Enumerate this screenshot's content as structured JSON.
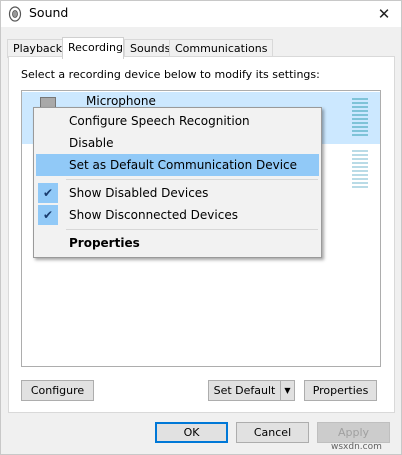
{
  "window": {
    "title": "Sound",
    "icons": {
      "app": "speaker-icon",
      "close": "close-icon"
    },
    "close_glyph": "✕"
  },
  "tabs": [
    {
      "label": "Playback",
      "active": false
    },
    {
      "label": "Recording",
      "active": true
    },
    {
      "label": "Sounds",
      "active": false
    },
    {
      "label": "Communications",
      "active": false
    }
  ],
  "panel": {
    "instruction": "Select a recording device below to modify its settings:",
    "devices": [
      {
        "name": "Microphone",
        "selected": true
      },
      {
        "name": "",
        "selected": false
      }
    ]
  },
  "context_menu": {
    "items": [
      {
        "label": "Configure Speech Recognition",
        "checked": false,
        "highlighted": false,
        "bold": false
      },
      {
        "label": "Disable",
        "checked": false,
        "highlighted": false,
        "bold": false
      },
      {
        "label": "Set as Default Communication Device",
        "checked": false,
        "highlighted": true,
        "bold": false
      },
      {
        "label": "Show Disabled Devices",
        "checked": true,
        "highlighted": false,
        "bold": false
      },
      {
        "label": "Show Disconnected Devices",
        "checked": true,
        "highlighted": false,
        "bold": false
      },
      {
        "label": "Properties",
        "checked": false,
        "highlighted": false,
        "bold": true
      }
    ],
    "check_glyph": "✔"
  },
  "panel_buttons": {
    "configure": "Configure",
    "set_default": "Set Default",
    "properties": "Properties",
    "dropdown_glyph": "▼"
  },
  "dialog_buttons": {
    "ok": "OK",
    "cancel": "Cancel",
    "apply": "Apply"
  },
  "watermark": "wsxdn.com",
  "colors": {
    "selection": "#cce8ff",
    "menu_highlight": "#91c9f7",
    "primary_border": "#0078d7",
    "level_meter": "#7ec3d8"
  }
}
